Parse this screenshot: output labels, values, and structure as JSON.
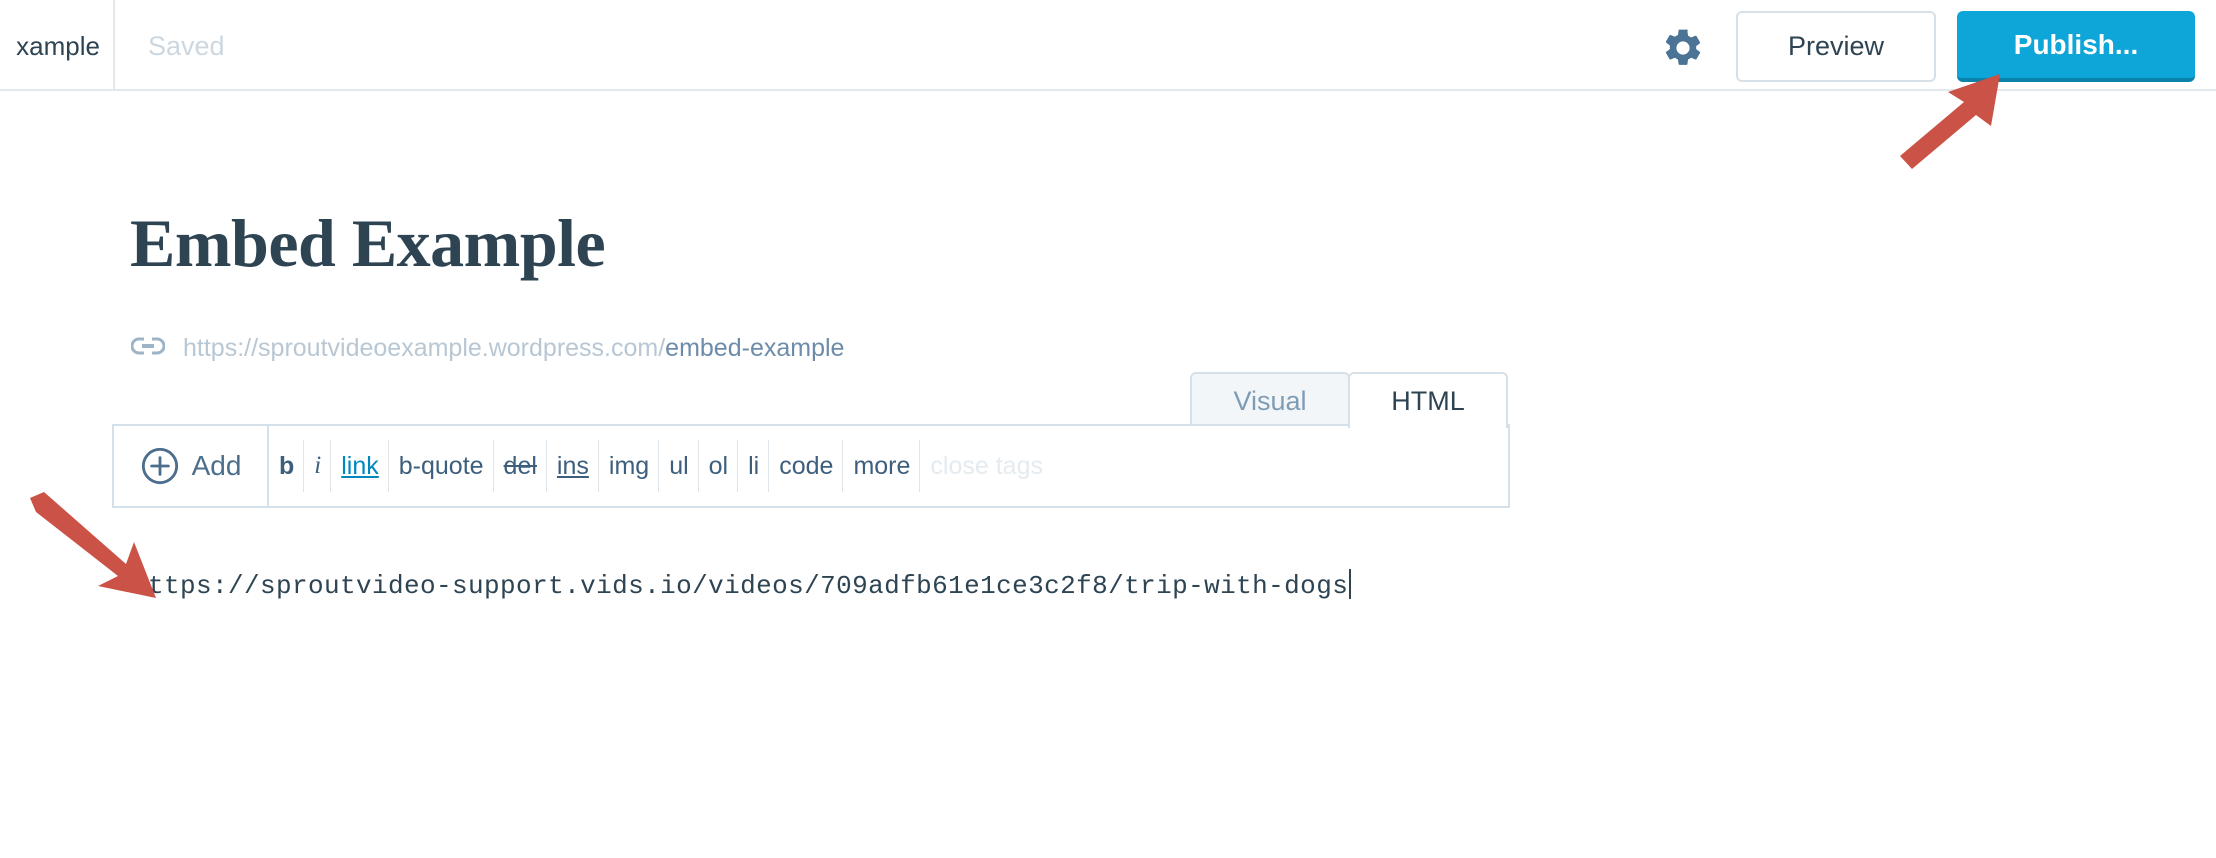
{
  "header": {
    "site_title": "xample",
    "save_status": "Saved",
    "gear_icon": "gear-icon",
    "preview_label": "Preview",
    "publish_label": "Publish...",
    "publish_color": "#0ea5d8",
    "preview_border_color": "#d6e0e8"
  },
  "post": {
    "title": "Embed Example",
    "title_color": "#2e4453",
    "permalink_icon": "link-icon",
    "permalink_base": "https://sproutvideoexample.wordpress.com/",
    "permalink_slug": "embed-example",
    "permalink_base_color": "#b8c7d4",
    "permalink_slug_color": "#6c8caa"
  },
  "editor": {
    "tabs": [
      {
        "label": "Visual",
        "active": false
      },
      {
        "label": "HTML",
        "active": true
      }
    ],
    "toolbar": {
      "add_label": "Add",
      "add_icon": "plus-circle-icon",
      "buttons": [
        {
          "label": "b",
          "style": "bold"
        },
        {
          "label": "i",
          "style": "italic"
        },
        {
          "label": "link",
          "style": "linkstyle"
        },
        {
          "label": "b-quote",
          "style": ""
        },
        {
          "label": "del",
          "style": "delstyle"
        },
        {
          "label": "ins",
          "style": "insstyle"
        },
        {
          "label": "img",
          "style": ""
        },
        {
          "label": "ul",
          "style": ""
        },
        {
          "label": "ol",
          "style": ""
        },
        {
          "label": "li",
          "style": ""
        },
        {
          "label": "code",
          "style": ""
        },
        {
          "label": "more",
          "style": ""
        },
        {
          "label": "close tags",
          "style": "disabled"
        }
      ]
    },
    "content": "https://sproutvideo-support.vids.io/videos/709adfb61e1ce3c2f8/trip-with-dogs"
  },
  "annotations": {
    "arrow_color": "#cb5246",
    "arrows": [
      {
        "name": "arrow-to-publish-button",
        "direction": "up-right"
      },
      {
        "name": "arrow-to-editor-content",
        "direction": "down-right"
      }
    ]
  }
}
